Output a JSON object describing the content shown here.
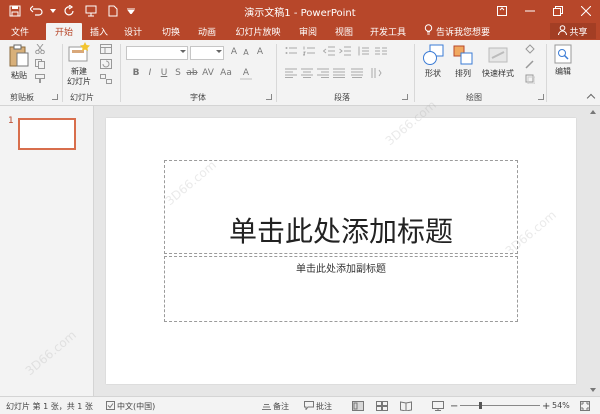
{
  "titlebar": {
    "title": "演示文稿1 - PowerPoint"
  },
  "tabs": {
    "file": "文件",
    "home": "开始",
    "insert": "插入",
    "design": "设计",
    "transitions": "切换",
    "animations": "动画",
    "slideshow": "幻灯片放映",
    "review": "审阅",
    "view": "视图",
    "developer": "开发工具"
  },
  "tellme": "告诉我您想要",
  "share": "共享",
  "ribbon": {
    "paste": "粘贴",
    "new_slide_line1": "新建",
    "new_slide_line2": "幻灯片",
    "shapes": "形状",
    "arrange": "排列",
    "quick_styles": "快速样式",
    "editing": "编辑",
    "groups": {
      "clipboard": "剪贴板",
      "slides": "幻灯片",
      "font": "字体",
      "paragraph": "段落",
      "drawing": "绘图"
    }
  },
  "thumbpane": {
    "slide_number": "1"
  },
  "slide": {
    "title_placeholder": "单击此处添加标题",
    "subtitle_placeholder": "单击此处添加副标题"
  },
  "statusbar": {
    "slide_info": "幻灯片 第 1 张，共 1 张",
    "language": "中文(中国)",
    "notes": "备注",
    "comments": "批注",
    "zoom": "54%"
  },
  "watermark": "3D66.com",
  "colors": {
    "accent": "#b7472a",
    "ribbon_bg": "#f3f3f3"
  }
}
